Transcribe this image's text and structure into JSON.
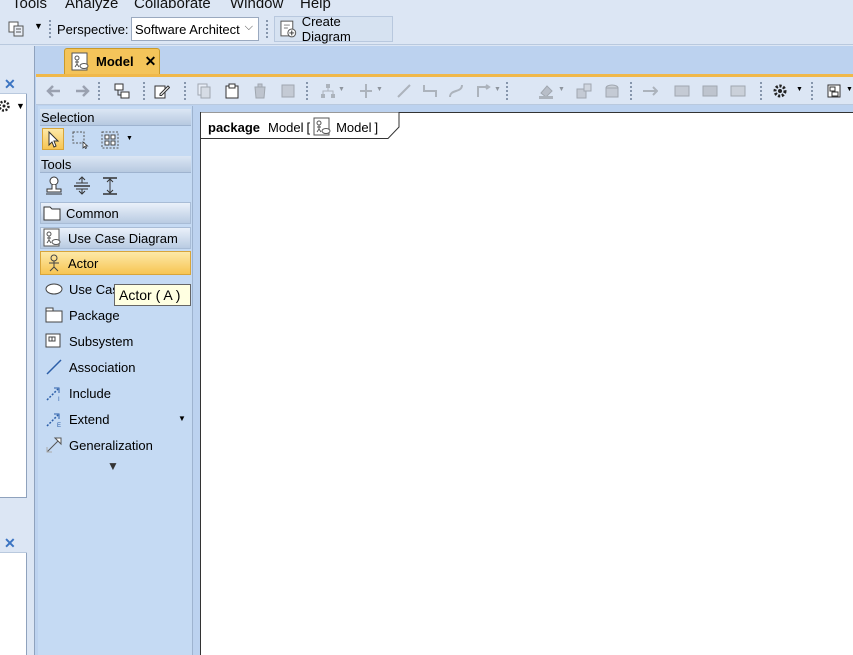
{
  "menu": {
    "items": [
      "Tools",
      "Analyze",
      "Collaborate",
      "Window",
      "Help"
    ]
  },
  "toolbar": {
    "perspective_label": "Perspective:",
    "perspective_value": "Software Architect",
    "create_diagram_label": "Create Diagram"
  },
  "tab": {
    "label": "Model"
  },
  "palette": {
    "selection_header": "Selection",
    "tools_header": "Tools",
    "groups": {
      "common": "Common",
      "use_case_diagram": "Use Case Diagram"
    },
    "items": {
      "actor": "Actor",
      "use_case": "Use Cas",
      "package": "Package",
      "subsystem": "Subsystem",
      "association": "Association",
      "include": "Include",
      "extend": "Extend",
      "generalization": "Generalization"
    },
    "tooltip": "Actor ( A )"
  },
  "diagram": {
    "frame_keyword": "package",
    "frame_name": "Model",
    "frame_diagram_name": "Model"
  },
  "colors": {
    "accent": "#f4c45a",
    "background": "#dce6f4",
    "palette": "#c5daf3"
  }
}
